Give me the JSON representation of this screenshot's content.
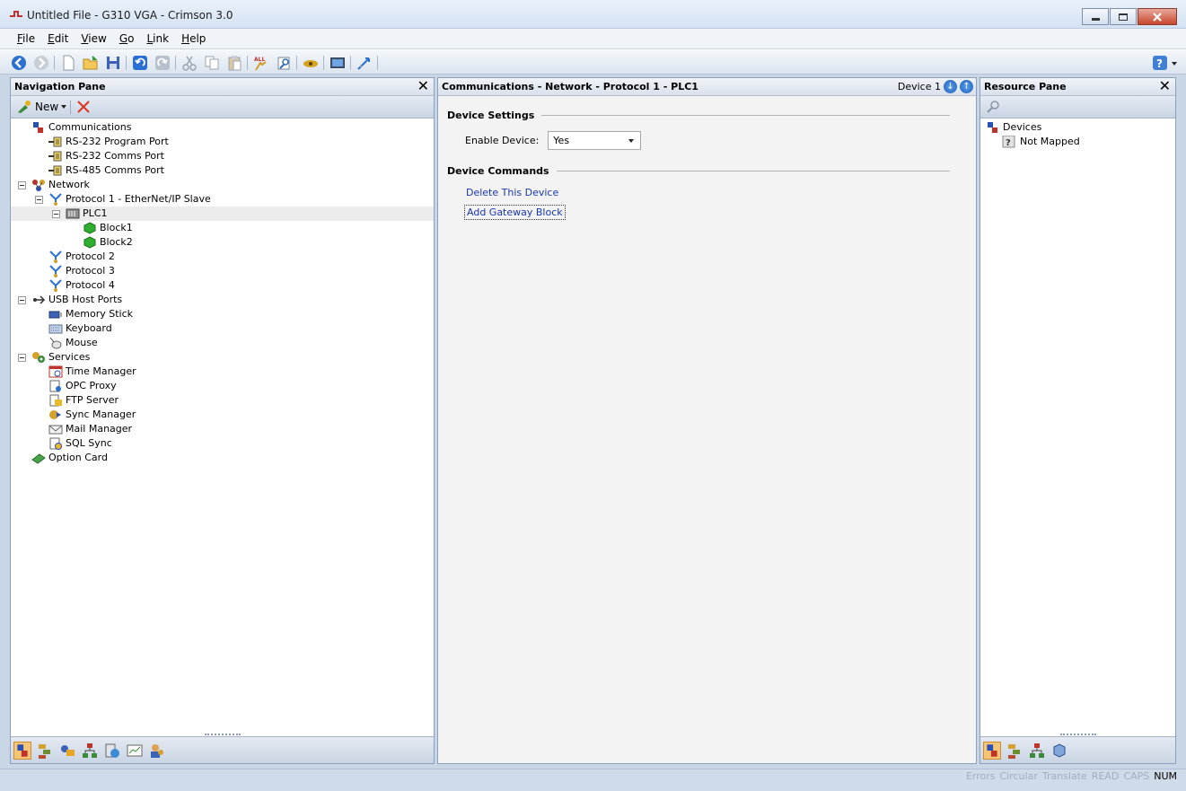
{
  "window": {
    "title": "Untitled File - G310 VGA - Crimson 3.0"
  },
  "menu": [
    {
      "accel": "F",
      "rest": "ile"
    },
    {
      "accel": "E",
      "rest": "dit"
    },
    {
      "accel": "V",
      "rest": "iew"
    },
    {
      "accel": "G",
      "rest": "o"
    },
    {
      "accel": "L",
      "rest": "ink"
    },
    {
      "accel": "H",
      "rest": "elp"
    }
  ],
  "nav_pane": {
    "title": "Navigation Pane",
    "new_label": "New",
    "tree": [
      {
        "label": "Communications",
        "level": 0,
        "icon": "communications-icon",
        "expander": false
      },
      {
        "label": "RS-232 Program Port",
        "level": 1,
        "icon": "serial-port-icon",
        "expander": false
      },
      {
        "label": "RS-232 Comms Port",
        "level": 1,
        "icon": "serial-port-icon",
        "expander": false
      },
      {
        "label": "RS-485 Comms Port",
        "level": 1,
        "icon": "serial-port-icon",
        "expander": false
      },
      {
        "label": "Network",
        "level": 0,
        "icon": "network-icon",
        "expander": true
      },
      {
        "label": "Protocol 1 - EtherNet/IP Slave",
        "level": 1,
        "icon": "protocol-icon",
        "expander": true
      },
      {
        "label": "PLC1",
        "level": 2,
        "icon": "plc-icon",
        "expander": true,
        "selected": true
      },
      {
        "label": "Block1",
        "level": 3,
        "icon": "block-icon",
        "expander": false
      },
      {
        "label": "Block2",
        "level": 3,
        "icon": "block-icon",
        "expander": false
      },
      {
        "label": "Protocol 2",
        "level": 1,
        "icon": "protocol-icon",
        "expander": false
      },
      {
        "label": "Protocol 3",
        "level": 1,
        "icon": "protocol-icon",
        "expander": false
      },
      {
        "label": "Protocol 4",
        "level": 1,
        "icon": "protocol-icon",
        "expander": false
      },
      {
        "label": "USB Host Ports",
        "level": 0,
        "icon": "usb-icon",
        "expander": true
      },
      {
        "label": "Memory Stick",
        "level": 1,
        "icon": "memory-stick-icon",
        "expander": false
      },
      {
        "label": "Keyboard",
        "level": 1,
        "icon": "keyboard-icon",
        "expander": false
      },
      {
        "label": "Mouse",
        "level": 1,
        "icon": "mouse-icon",
        "expander": false
      },
      {
        "label": "Services",
        "level": 0,
        "icon": "services-icon",
        "expander": true
      },
      {
        "label": "Time Manager",
        "level": 1,
        "icon": "time-manager-icon",
        "expander": false
      },
      {
        "label": "OPC Proxy",
        "level": 1,
        "icon": "opc-proxy-icon",
        "expander": false
      },
      {
        "label": "FTP Server",
        "level": 1,
        "icon": "ftp-server-icon",
        "expander": false
      },
      {
        "label": "Sync Manager",
        "level": 1,
        "icon": "sync-manager-icon",
        "expander": false
      },
      {
        "label": "Mail Manager",
        "level": 1,
        "icon": "mail-manager-icon",
        "expander": false
      },
      {
        "label": "SQL Sync",
        "level": 1,
        "icon": "sql-sync-icon",
        "expander": false
      },
      {
        "label": "Option Card",
        "level": 0,
        "icon": "option-card-icon",
        "expander": false
      }
    ]
  },
  "main_pane": {
    "breadcrumb": "Communications - Network - Protocol 1 - PLC1",
    "device_label": "Device 1",
    "settings_title": "Device Settings",
    "enable_label": "Enable Device:",
    "enable_value": "Yes",
    "commands_title": "Device Commands",
    "delete_link": "Delete This Device",
    "add_link": "Add Gateway Block"
  },
  "res_pane": {
    "title": "Resource Pane",
    "root": "Devices",
    "child": "Not Mapped"
  },
  "status": {
    "items": [
      {
        "label": "Errors",
        "on": false
      },
      {
        "label": "Circular",
        "on": false
      },
      {
        "label": "Translate",
        "on": false
      },
      {
        "label": "READ",
        "on": false
      },
      {
        "label": "CAPS",
        "on": false
      },
      {
        "label": "NUM",
        "on": true
      }
    ]
  },
  "colors": {
    "link": "#1a37b0",
    "accent": "#f6c575"
  }
}
